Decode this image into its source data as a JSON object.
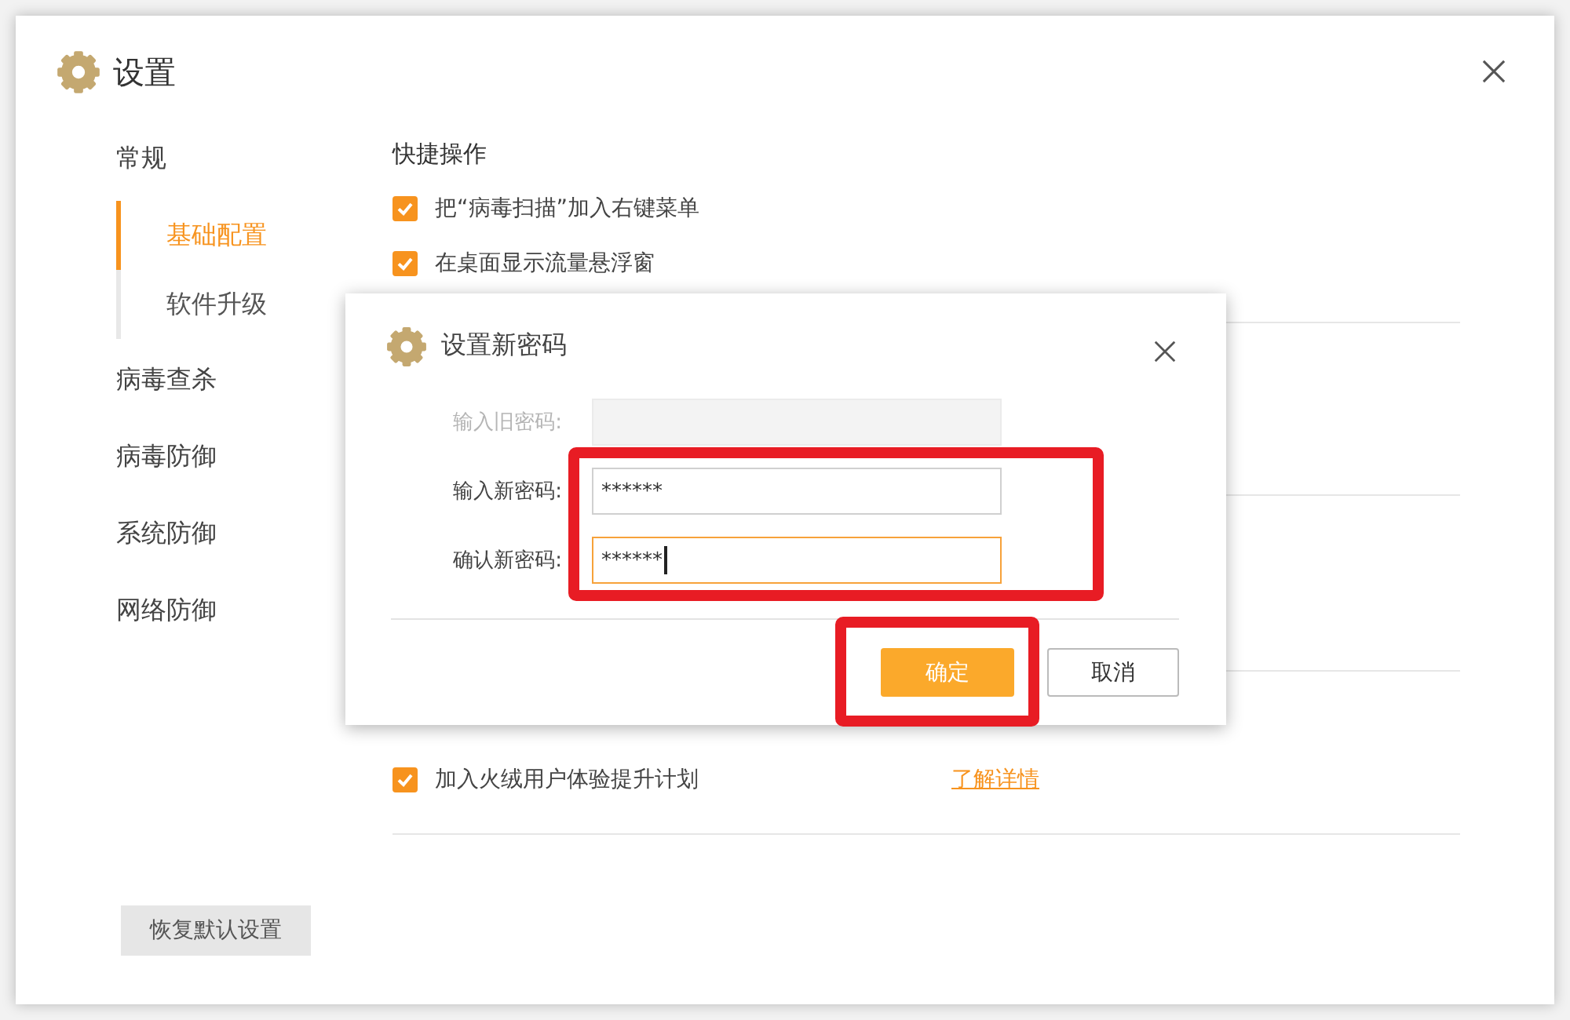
{
  "window": {
    "title": "设置"
  },
  "sidebar": {
    "items": [
      {
        "label": "常规",
        "selected": false,
        "children": [
          {
            "label": "基础配置",
            "selected": true
          },
          {
            "label": "软件升级",
            "selected": false
          }
        ]
      },
      {
        "label": "病毒查杀",
        "selected": false
      },
      {
        "label": "病毒防御",
        "selected": false
      },
      {
        "label": "系统防御",
        "selected": false
      },
      {
        "label": "网络防御",
        "selected": false
      }
    ]
  },
  "restore_button": "恢复默认设置",
  "sections": [
    {
      "heading": "快捷操作",
      "options": [
        {
          "label": "把“病毒扫描”加入右键菜单",
          "checked": true
        },
        {
          "label": "在桌面显示流量悬浮窗",
          "checked": true
        }
      ]
    },
    {
      "options": [
        {
          "label": "加入火绒用户体验提升计划",
          "checked": true,
          "link": "了解详情"
        }
      ]
    }
  ],
  "dialog": {
    "title": "设置新密码",
    "fields": [
      {
        "label": "输入旧密码:",
        "disabled": true,
        "focused": false,
        "highlighted": false
      },
      {
        "label": "输入新密码:",
        "value": "******",
        "disabled": false,
        "focused": false,
        "highlighted": true
      },
      {
        "label": "确认新密码:",
        "value": "******",
        "disabled": false,
        "focused": true,
        "highlighted": true
      }
    ],
    "buttons": [
      {
        "label": "确定",
        "kind": "primary",
        "highlighted": true
      },
      {
        "label": "取消",
        "kind": "secondary",
        "highlighted": false
      }
    ]
  }
}
